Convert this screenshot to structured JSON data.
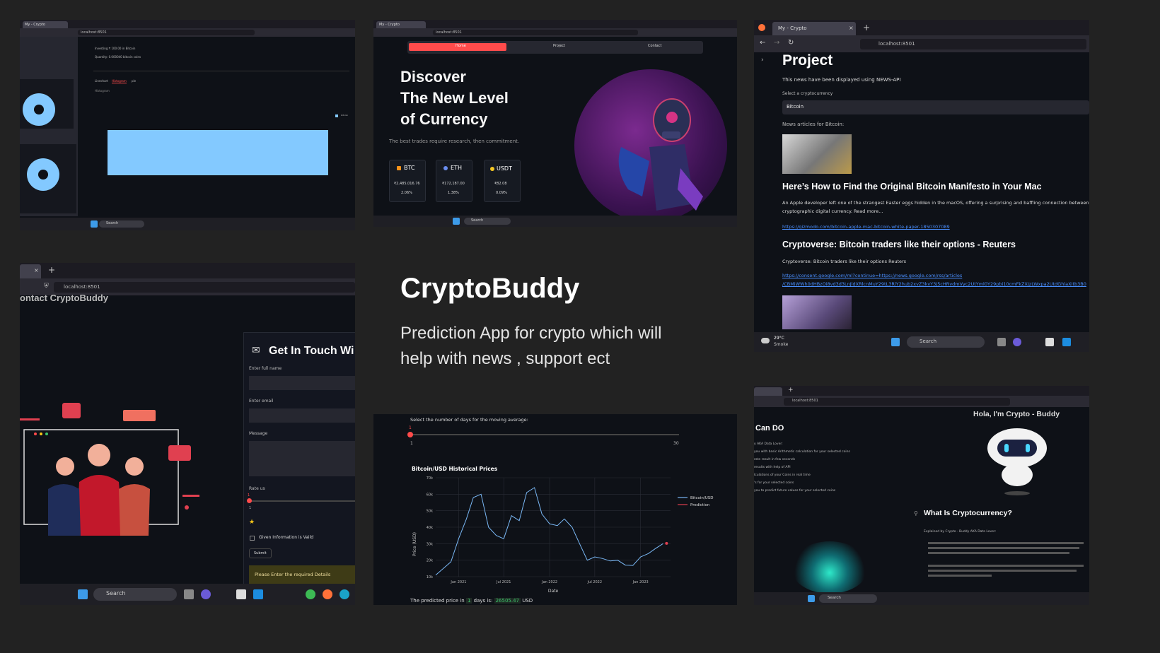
{
  "center": {
    "title": "CryptoBuddy",
    "subtitle_line1": "Prediction App for crypto which will",
    "subtitle_line2": "help with news , support ect"
  },
  "taskbar": {
    "search": "Search",
    "weather_temp": "29°C",
    "weather_desc": "Smoke"
  },
  "browser": {
    "tab_title": "My - Crypto",
    "url": "localhost:8501"
  },
  "chart_panel": {
    "tabs": [
      "Linechart",
      "Histogram",
      "pie"
    ],
    "section_label": "Histogram",
    "investing_text": "Investing ₹ 100.00 in Bitcoin",
    "quantity_text": "Quantity: 0.000040 bitcoin coins",
    "legend": "bitcoin"
  },
  "home_panel": {
    "nav": [
      "Home",
      "Project",
      "Contact"
    ],
    "headline1": "Discover",
    "headline2": "The New Level",
    "headline3": "of Currency",
    "tagline": "The best trades require research, then commitment.",
    "coins": [
      {
        "name": "BTC",
        "price": "₹2,485,016.76",
        "change": "2.06%"
      },
      {
        "name": "ETH",
        "price": "₹172,187.00",
        "change": "1.38%"
      },
      {
        "name": "USDT",
        "price": "₹82.08",
        "change": "0.09%"
      }
    ]
  },
  "project_panel": {
    "title": "Project",
    "news_note": "This news have been displayed using NEWS-API",
    "select_label": "Select a cryptocurrency",
    "select_value": "Bitcoin",
    "articles_label": "News articles for Bitcoin:",
    "article1_title": "Here’s How to Find the Original Bitcoin Manifesto in Your Mac",
    "article1_desc1": "An Apple developer left one of the strangest Easter eggs hidden in the macOS, offering a surprising and baffling connection between t",
    "article1_desc2": "cryptographic digital currency. Read more...",
    "article1_link": "https://gizmodo.com/bitcoin-apple-mac-bitcoin-white-paper-1850307089",
    "article2_title": "Cryptoverse: Bitcoin traders like their options - Reuters",
    "article2_desc": "Cryptoverse: Bitcoin traders like their options  Reuters",
    "article2_link1": "https://consent.google.com/ml?continue=https://news.google.com/rss/articles",
    "article2_link2": "/CBMiWWh0dHBzOi8vd3d3LnJldXRlcnMuY29tL3RlY2hub2xvZ3kvY3J5cHRvdmVyc2UtYml0Y29pbi10cmFkZXJzLWxpa2UtdGhlaXItb3B0"
  },
  "contact_panel": {
    "partial_title": "ontact CryptoBuddy",
    "heading": "Get In Touch Wi",
    "name_label": "Enter full name",
    "email_label": "Enter email",
    "message_label": "Message",
    "rate_label": "Rate us",
    "rate_value": "1",
    "rate_low": "1",
    "checkbox_label": "Given Information is Vaild",
    "submit": "Submit",
    "warning": "Please Enter the required Details"
  },
  "price_panel": {
    "slider_label": "Select the number of days for the moving average:",
    "slider_value": "1",
    "slider_min": "1",
    "slider_max": "30",
    "bottom_text": "The predicted price in",
    "bottom_days": "1",
    "bottom_mid": "days is:",
    "bottom_value": "26505.47",
    "bottom_unit": "USD"
  },
  "chart_data": {
    "type": "line",
    "title": "Bitcoin/USD Historical Prices",
    "xlabel": "Date",
    "ylabel": "Price (USD)",
    "yticks": [
      "10k",
      "20k",
      "30k",
      "40k",
      "50k",
      "60k",
      "70k"
    ],
    "xticks": [
      "Jan 2021",
      "Jul 2021",
      "Jan 2022",
      "Jul 2022",
      "Jan 2023"
    ],
    "ylim": [
      10000,
      70000
    ],
    "grid": true,
    "legend_position": "right",
    "series": [
      {
        "name": "Bitcoin/USD",
        "color": "#7ab8f5",
        "x": [
          "2020-10-01",
          "2020-11-01",
          "2020-12-01",
          "2021-01-01",
          "2021-02-01",
          "2021-03-01",
          "2021-04-01",
          "2021-05-01",
          "2021-06-01",
          "2021-07-01",
          "2021-08-01",
          "2021-09-01",
          "2021-10-01",
          "2021-11-01",
          "2021-12-01",
          "2022-01-01",
          "2022-02-01",
          "2022-03-01",
          "2022-04-01",
          "2022-05-01",
          "2022-06-01",
          "2022-07-01",
          "2022-08-01",
          "2022-09-01",
          "2022-10-01",
          "2022-11-01",
          "2022-12-01",
          "2023-01-01",
          "2023-02-01",
          "2023-03-01",
          "2023-04-01"
        ],
        "y": [
          11000,
          15000,
          19000,
          33000,
          45000,
          58000,
          60000,
          40000,
          35000,
          33000,
          47000,
          44000,
          61000,
          64000,
          48000,
          42000,
          41000,
          45000,
          40000,
          30000,
          20000,
          22000,
          21000,
          19500,
          20000,
          17000,
          16800,
          22000,
          24000,
          27000,
          30000
        ]
      },
      {
        "name": "Prediction",
        "color": "#e04050",
        "x": [
          "2023-04-15"
        ],
        "y": [
          30200
        ]
      }
    ]
  },
  "bot_panel": {
    "hello": "Hola, I'm Crypto - Buddy",
    "can_do": "Can DO",
    "lines": [
      "y AKA Data Lover:",
      "you with basic Arithmetic calculation for your selected coins",
      "rate result in few seconds",
      "results with help of API",
      "lculations of your Coins in real time",
      "'s for your selected coins",
      "you to predict future values for your selected coins"
    ],
    "what_is": "What Is Cryptocurrency?",
    "explained": "Explained by Crypto - Buddy AKA Data Lover:"
  }
}
